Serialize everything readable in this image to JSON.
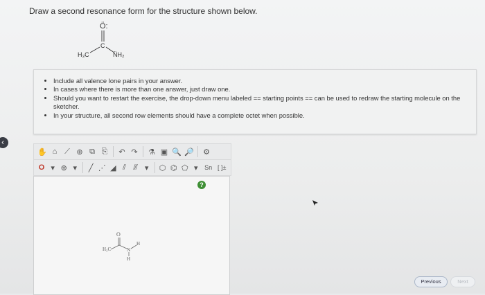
{
  "question": {
    "title": "Draw a second resonance form for the structure shown below."
  },
  "molecule": {
    "oxygen": "Ö:",
    "carbon": "C",
    "left_group": "H₃C",
    "right_group": "N̈H₂"
  },
  "instructions": {
    "items": [
      "Include all valence lone pairs in your answer.",
      "In cases where there is more than one answer, just draw one.",
      "Should you want to restart the exercise, the drop-down menu labeled == starting points == can be used to redraw the starting molecule on the sketcher.",
      "In your structure, all second row elements should have a complete octet when possible."
    ]
  },
  "toolbar": {
    "row2_element": "O",
    "row2_charge": "⊕",
    "sn_label": "Sn",
    "bracket_label": "[ ]±"
  },
  "sketcher": {
    "help_label": "?",
    "drawn_o": "O",
    "drawn_h3c": "H₃C",
    "drawn_n": "N",
    "drawn_h_right": "H",
    "drawn_h_bottom": "H"
  },
  "navigation": {
    "previous_label": "Previous",
    "next_label": "Next"
  },
  "colors": {
    "help_green": "#3f8f35",
    "previous_border": "#aab6c8"
  }
}
